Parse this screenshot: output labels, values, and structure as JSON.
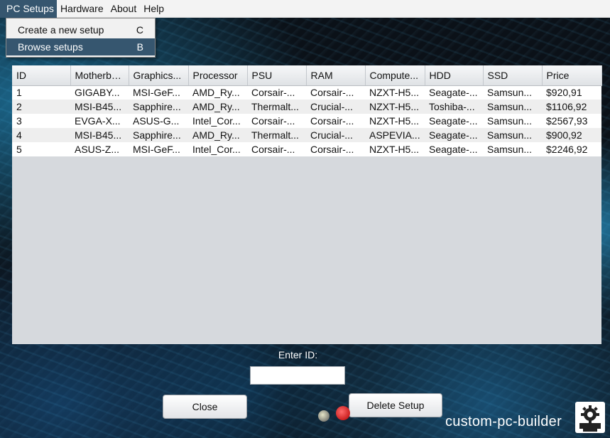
{
  "menubar": {
    "items": [
      {
        "label": "PC Setups"
      },
      {
        "label": "Hardware"
      },
      {
        "label": "About"
      },
      {
        "label": "Help"
      }
    ]
  },
  "dropdown": {
    "items": [
      {
        "label": "Create a new setup",
        "shortcut": "C"
      },
      {
        "label": "Browse setups",
        "shortcut": "B"
      }
    ]
  },
  "table": {
    "columns": [
      "ID",
      "Motherbo...",
      "Graphics...",
      "Processor",
      "PSU",
      "RAM",
      "Compute...",
      "HDD",
      "SSD",
      "Price"
    ],
    "rows": [
      [
        "1",
        "GIGABY...",
        "MSI-GeF...",
        "AMD_Ry...",
        "Corsair-...",
        "Corsair-...",
        "NZXT-H5...",
        "Seagate-...",
        "Samsun...",
        "$920,91"
      ],
      [
        "2",
        "MSI-B45...",
        "Sapphire...",
        "AMD_Ry...",
        "Thermalt...",
        "Crucial-...",
        "NZXT-H5...",
        "Toshiba-...",
        "Samsun...",
        "$1106,92"
      ],
      [
        "3",
        "EVGA-X...",
        "ASUS-G...",
        "Intel_Cor...",
        "Corsair-...",
        "Corsair-...",
        "NZXT-H5...",
        "Seagate-...",
        "Samsun...",
        "$2567,93"
      ],
      [
        "4",
        "MSI-B45...",
        "Sapphire...",
        "AMD_Ry...",
        "Thermalt...",
        "Crucial-...",
        "ASPEVIA...",
        "Seagate-...",
        "Samsun...",
        "$900,92"
      ],
      [
        "5",
        "ASUS-Z...",
        "MSI-GeF...",
        "Intel_Cor...",
        "Corsair-...",
        "Corsair-...",
        "NZXT-H5...",
        "Seagate-...",
        "Samsun...",
        "$2246,92"
      ]
    ]
  },
  "form": {
    "id_label": "Enter ID:",
    "id_value": "",
    "close_label": "Close",
    "delete_label": "Delete Setup"
  },
  "branding": {
    "name": "custom-pc-builder",
    "logo_icon": "gear-icon"
  },
  "colors": {
    "menu_highlight": "#36566f"
  }
}
